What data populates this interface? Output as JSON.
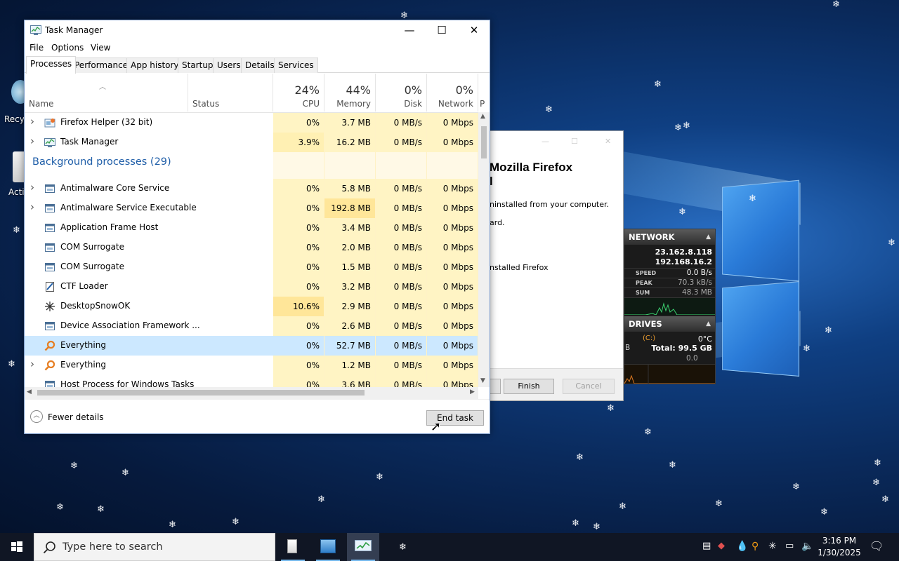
{
  "desktop": {
    "icons": [
      {
        "label": "Recy"
      },
      {
        "label": "Acti"
      }
    ]
  },
  "task_manager": {
    "title": "Task Manager",
    "menu": [
      "File",
      "Options",
      "View"
    ],
    "tabs": [
      "Processes",
      "Performance",
      "App history",
      "Startup",
      "Users",
      "Details",
      "Services"
    ],
    "columns": {
      "name": "Name",
      "status": "Status",
      "cpu": {
        "pct": "24%",
        "label": "CPU"
      },
      "memory": {
        "pct": "44%",
        "label": "Memory"
      },
      "disk": {
        "pct": "0%",
        "label": "Disk"
      },
      "network": {
        "pct": "0%",
        "label": "Network"
      },
      "power": "P"
    },
    "rows": [
      {
        "type": "process",
        "expandable": true,
        "icon": "firefox-helper-icon",
        "name": "Firefox Helper (32 bit)",
        "cpu": "0%",
        "memory": "3.7 MB",
        "disk": "0 MB/s",
        "network": "0 Mbps"
      },
      {
        "type": "process",
        "expandable": true,
        "icon": "task-manager-icon",
        "name": "Task Manager",
        "cpu": "3.9%",
        "memory": "16.2 MB",
        "disk": "0 MB/s",
        "network": "0 Mbps"
      },
      {
        "type": "group",
        "name": "Background processes (29)"
      },
      {
        "type": "process",
        "expandable": true,
        "icon": "service-icon",
        "name": "Antimalware Core Service",
        "cpu": "0%",
        "memory": "5.8 MB",
        "disk": "0 MB/s",
        "network": "0 Mbps"
      },
      {
        "type": "process",
        "expandable": true,
        "icon": "service-icon",
        "name": "Antimalware Service Executable",
        "cpu": "0%",
        "memory": "192.8 MB",
        "disk": "0 MB/s",
        "network": "0 Mbps"
      },
      {
        "type": "process",
        "expandable": false,
        "icon": "service-icon",
        "name": "Application Frame Host",
        "cpu": "0%",
        "memory": "3.4 MB",
        "disk": "0 MB/s",
        "network": "0 Mbps"
      },
      {
        "type": "process",
        "expandable": false,
        "icon": "service-icon",
        "name": "COM Surrogate",
        "cpu": "0%",
        "memory": "2.0 MB",
        "disk": "0 MB/s",
        "network": "0 Mbps"
      },
      {
        "type": "process",
        "expandable": false,
        "icon": "service-icon",
        "name": "COM Surrogate",
        "cpu": "0%",
        "memory": "1.5 MB",
        "disk": "0 MB/s",
        "network": "0 Mbps"
      },
      {
        "type": "process",
        "expandable": false,
        "icon": "ctf-loader-icon",
        "name": "CTF Loader",
        "cpu": "0%",
        "memory": "3.2 MB",
        "disk": "0 MB/s",
        "network": "0 Mbps"
      },
      {
        "type": "process",
        "expandable": false,
        "icon": "snowflake-icon",
        "name": "DesktopSnowOK",
        "cpu": "10.6%",
        "memory": "2.9 MB",
        "disk": "0 MB/s",
        "network": "0 Mbps"
      },
      {
        "type": "process",
        "expandable": false,
        "icon": "service-icon",
        "name": "Device Association Framework ...",
        "cpu": "0%",
        "memory": "2.6 MB",
        "disk": "0 MB/s",
        "network": "0 Mbps"
      },
      {
        "type": "process",
        "expandable": false,
        "selected": true,
        "icon": "everything-search-icon",
        "name": "Everything",
        "cpu": "0%",
        "memory": "52.7 MB",
        "disk": "0 MB/s",
        "network": "0 Mbps"
      },
      {
        "type": "process",
        "expandable": true,
        "icon": "everything-search-icon",
        "name": "Everything",
        "cpu": "0%",
        "memory": "1.2 MB",
        "disk": "0 MB/s",
        "network": "0 Mbps"
      },
      {
        "type": "process",
        "expandable": false,
        "icon": "service-icon",
        "name": "Host Process for Windows Tasks",
        "cpu": "0%",
        "memory": "3.6 MB",
        "disk": "0 MB/s",
        "network": "0 Mbps"
      }
    ],
    "fewer_details": "Fewer details",
    "end_task": "End task"
  },
  "firefox_uninstaller": {
    "title_line1": "Mozilla Firefox",
    "title_line2": "l",
    "text1": "ninstalled from your computer.",
    "text2": "ard.",
    "text3": "nstalled Firefox",
    "finish": "Finish",
    "cancel": "Cancel"
  },
  "gadget": {
    "network_header": "NETWORK",
    "ip1": "23.162.8.118",
    "ip2": "192.168.16.2",
    "speed_label": "SPEED",
    "speed_value": "0.0 B/s",
    "peak_label": "PEAK",
    "peak_value": "70.3 kB/s",
    "sum_label": "SUM",
    "sum_value": "48.3 MB",
    "drives_header": "DRIVES",
    "temp": "0°C",
    "drive_letter": "(C:)",
    "drive_left": "B",
    "drive_total": "Total: 99.5 GB",
    "drive_rate": "0.0"
  },
  "taskbar": {
    "search_placeholder": "Type here to search",
    "time": "3:16 PM",
    "date": "1/30/2025"
  }
}
